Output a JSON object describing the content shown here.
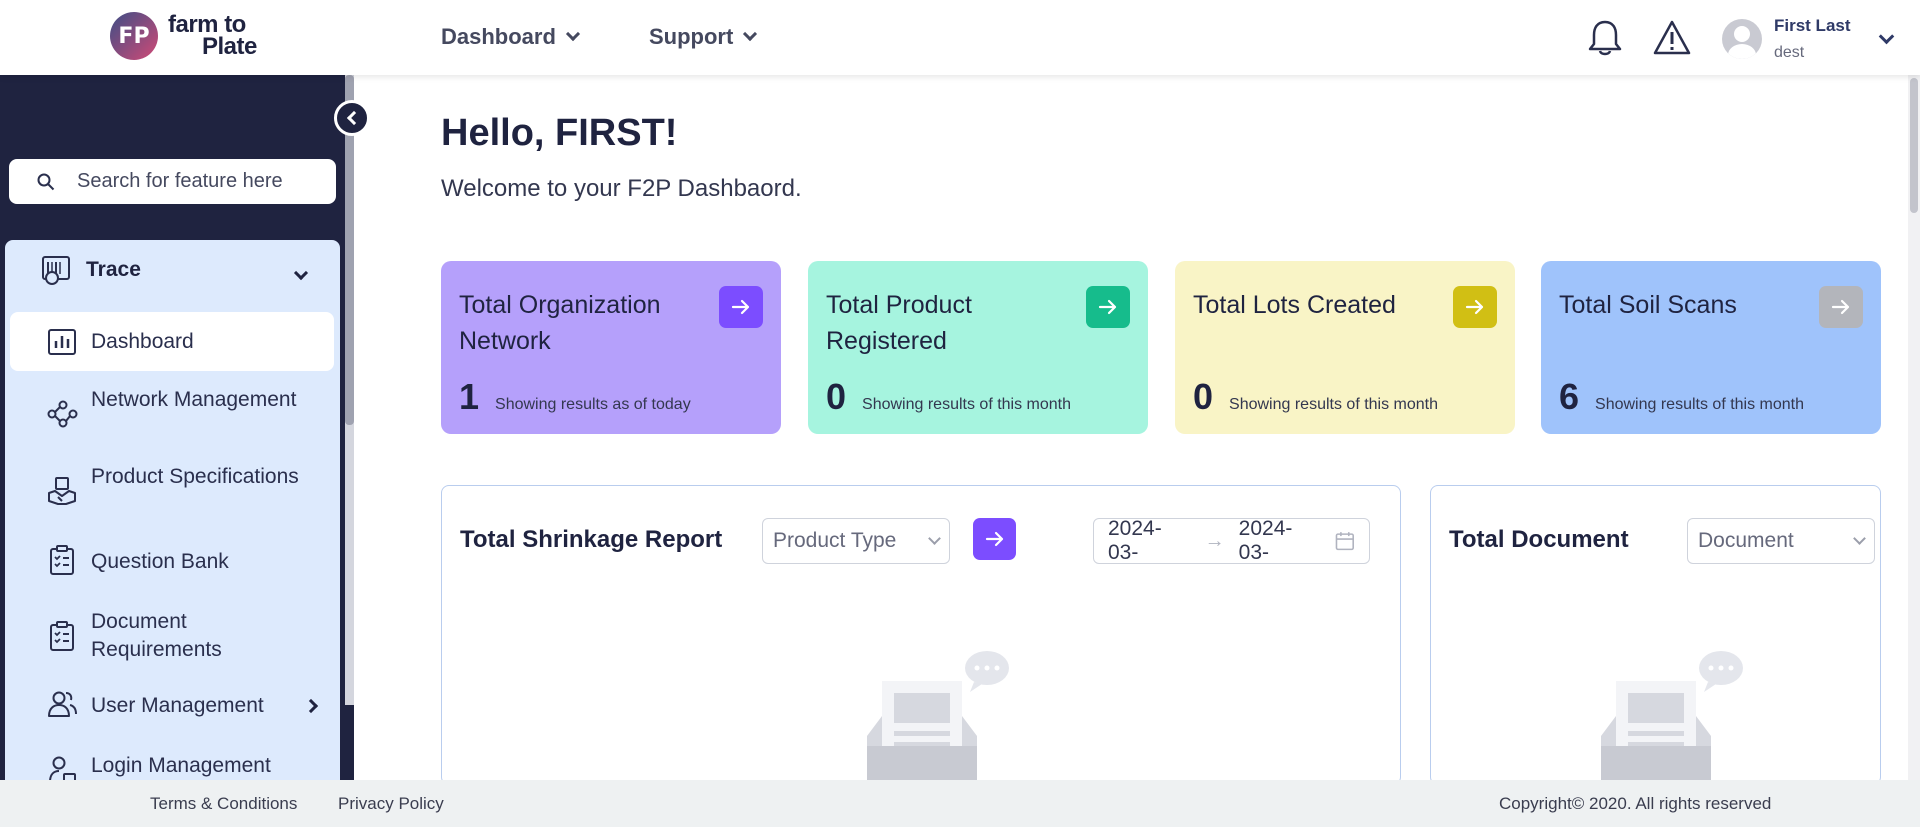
{
  "header": {
    "logo_mark": "FP",
    "logo_line1": "farm to",
    "logo_line2": "Plate",
    "nav": [
      {
        "label": "Dashboard"
      },
      {
        "label": "Support"
      }
    ],
    "user": {
      "name": "First Last",
      "role": "dest"
    }
  },
  "sidebar": {
    "search_placeholder": "Search for feature here",
    "group_label": "Trace",
    "items": [
      {
        "label": "Dashboard",
        "icon": "bar-chart-icon",
        "active": true
      },
      {
        "label": "Network Management",
        "icon": "network-icon"
      },
      {
        "label": "Product Specifications",
        "icon": "product-handshake-icon"
      },
      {
        "label": "Question Bank",
        "icon": "clipboard-checklist-icon"
      },
      {
        "label": "Document Requirements",
        "icon": "clipboard-checklist-icon"
      },
      {
        "label": "User Management",
        "icon": "users-icon"
      },
      {
        "label": "Login Management",
        "icon": "user-lock-icon"
      }
    ]
  },
  "main": {
    "greeting": "Hello, FIRST!",
    "welcome": "Welcome to your F2P Dashbaord.",
    "cards": [
      {
        "title": "Total Organization Network",
        "value": "1",
        "subtitle": "Showing results as of today",
        "bg": "#b5a0fb",
        "btn": "#7c4dff"
      },
      {
        "title": "Total Product Registered",
        "value": "0",
        "subtitle": "Showing results of this month",
        "bg": "#a6f4df",
        "btn": "#16bc8c"
      },
      {
        "title": "Total Lots Created",
        "value": "0",
        "subtitle": "Showing results of this month",
        "bg": "#f9f4c6",
        "btn": "#d1bf14"
      },
      {
        "title": "Total Soil Scans",
        "value": "6",
        "subtitle": "Showing results of this month",
        "bg": "#9fc3fb",
        "btn": "#b3b5bb"
      }
    ],
    "shrinkage": {
      "title": "Total Shrinkage Report",
      "product_type_placeholder": "Product Type",
      "date_start": "2024-03-",
      "date_end": "2024-03-"
    },
    "documents": {
      "title": "Total Document",
      "select_placeholder": "Document"
    }
  },
  "footer": {
    "terms": "Terms & Conditions",
    "privacy": "Privacy Policy",
    "copyright": "Copyright© 2020. All rights reserved"
  }
}
